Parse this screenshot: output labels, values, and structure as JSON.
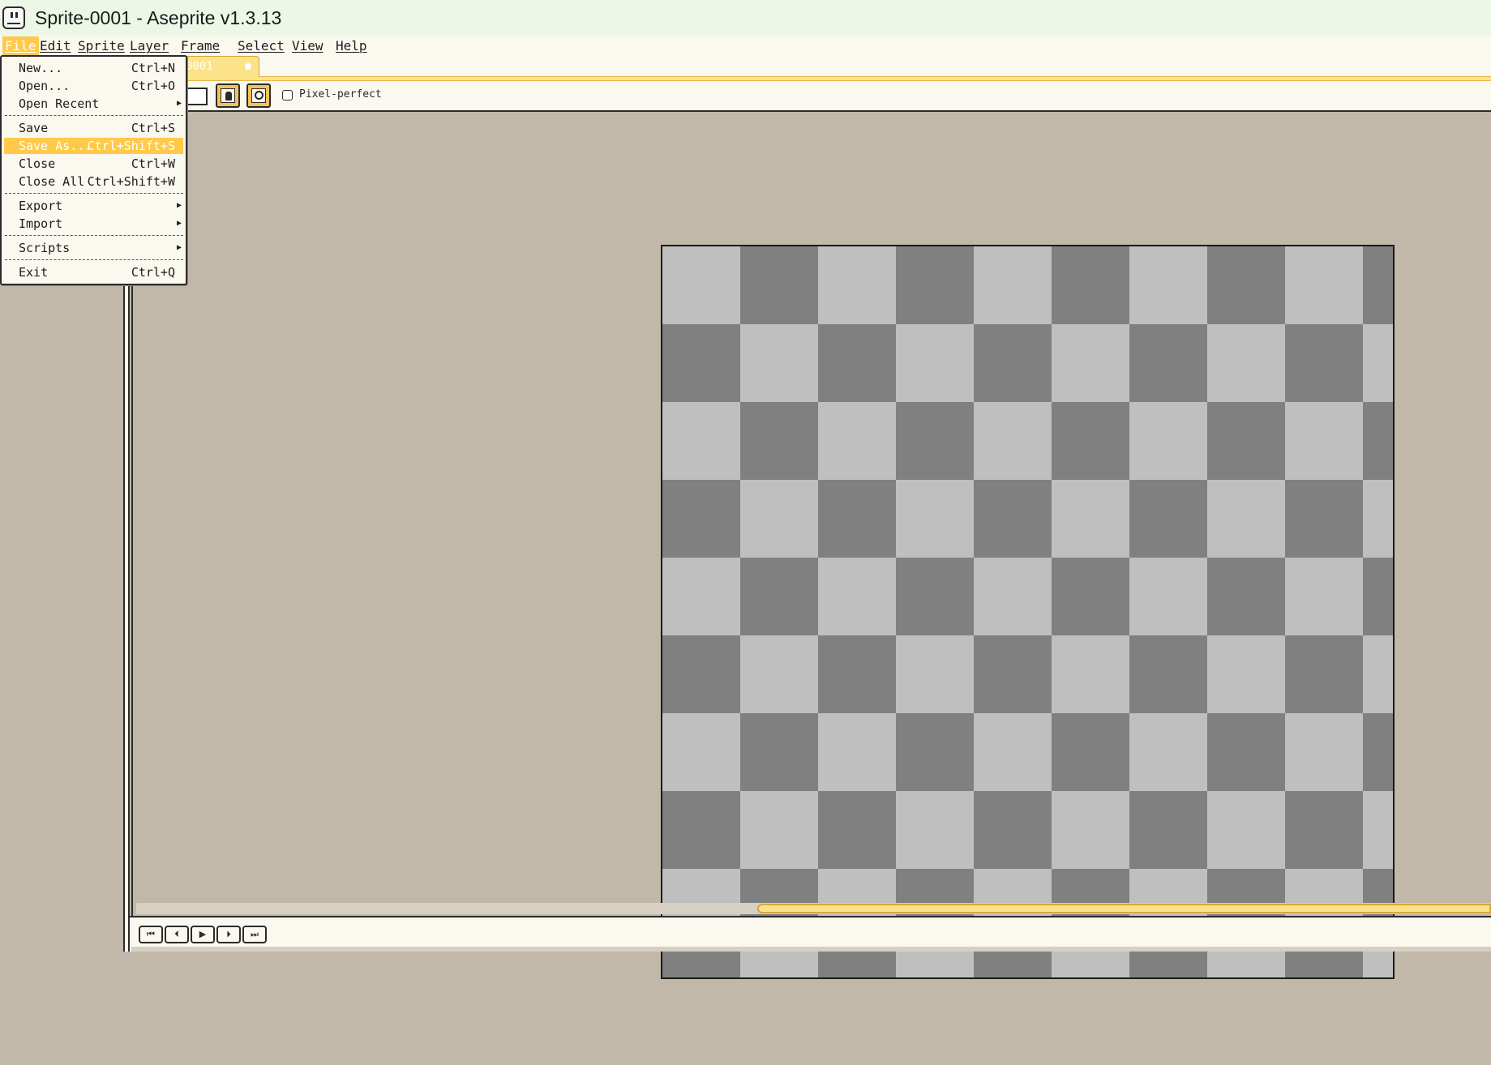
{
  "window": {
    "title": "Sprite-0001 - Aseprite v1.3.13",
    "icon": "aseprite-app-icon"
  },
  "menubar": {
    "items": [
      "File",
      "Edit",
      "Sprite",
      "Layer",
      "Frame",
      "Select",
      "View",
      "Help"
    ],
    "active": "File"
  },
  "tabs": [
    {
      "label": "0001",
      "modified": true
    }
  ],
  "context_bar": {
    "pixel_perfect_label": "Pixel-perfect",
    "pixel_perfect_checked": false,
    "ink_icon": "ink-icon",
    "pixel_icon": "magnify-pixel-icon"
  },
  "file_menu": {
    "items": [
      {
        "label": "New...",
        "shortcut": "Ctrl+N"
      },
      {
        "label": "Open...",
        "shortcut": "Ctrl+O"
      },
      {
        "label": "Open Recent",
        "shortcut": "",
        "submenu": true
      },
      {
        "label": "Save",
        "shortcut": "Ctrl+S"
      },
      {
        "label": "Save As...",
        "shortcut": "Ctrl+Shift+S",
        "selected": true
      },
      {
        "label": "Close",
        "shortcut": "Ctrl+W"
      },
      {
        "label": "Close All",
        "shortcut": "Ctrl+Shift+W"
      },
      {
        "label": "Export",
        "shortcut": "",
        "submenu": true
      },
      {
        "label": "Import",
        "shortcut": "",
        "submenu": true
      },
      {
        "label": "Scripts",
        "shortcut": "",
        "submenu": true
      },
      {
        "label": "Exit",
        "shortcut": "Ctrl+Q"
      }
    ]
  },
  "timeline": {
    "buttons": [
      "first-frame",
      "previous-frame",
      "play",
      "next-frame",
      "last-frame"
    ]
  },
  "colors": {
    "accent": "#ffc94a",
    "tab_yellow": "#fce38a",
    "workspace": "#c1b8aa",
    "checker_dark": "#808080",
    "checker_light": "#bfbfbf"
  }
}
